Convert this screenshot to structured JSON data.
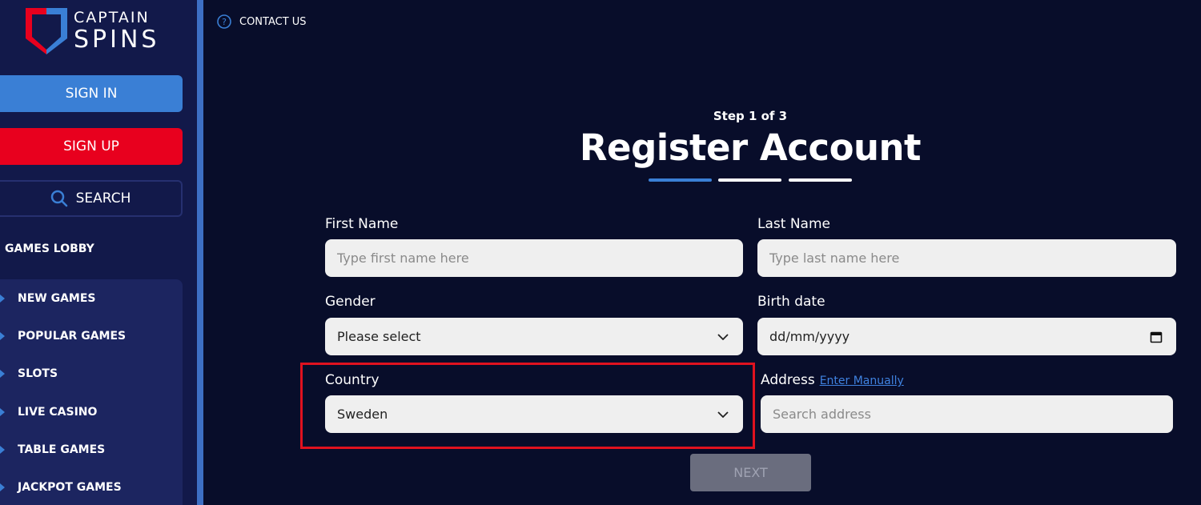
{
  "brand": {
    "line1": "CAPTAIN",
    "line2": "SPINS"
  },
  "sidebar": {
    "sign_in": "SIGN IN",
    "sign_up": "SIGN UP",
    "search": "SEARCH",
    "lobby": "GAMES LOBBY",
    "items": [
      {
        "label": "NEW GAMES"
      },
      {
        "label": "POPULAR GAMES"
      },
      {
        "label": "SLOTS"
      },
      {
        "label": "LIVE CASINO"
      },
      {
        "label": "TABLE GAMES"
      },
      {
        "label": "JACKPOT GAMES"
      }
    ]
  },
  "header": {
    "contact": "CONTACT US"
  },
  "form": {
    "step": "Step 1 of 3",
    "title": "Register Account",
    "first_name": {
      "label": "First Name",
      "placeholder": "Type first name here"
    },
    "last_name": {
      "label": "Last Name",
      "placeholder": "Type last name here"
    },
    "gender": {
      "label": "Gender",
      "value": "Please select"
    },
    "birth_date": {
      "label": "Birth date",
      "placeholder": "dd/mm/yyyy"
    },
    "country": {
      "label": "Country",
      "value": "Sweden"
    },
    "address": {
      "label": "Address",
      "link": "Enter Manually",
      "placeholder": "Search address"
    },
    "next": "NEXT"
  },
  "colors": {
    "background": "#080d2a",
    "sidebar": "#12194a",
    "accent_blue": "#3a7fd5",
    "accent_red": "#e8001e",
    "highlight": "#e0121f"
  }
}
